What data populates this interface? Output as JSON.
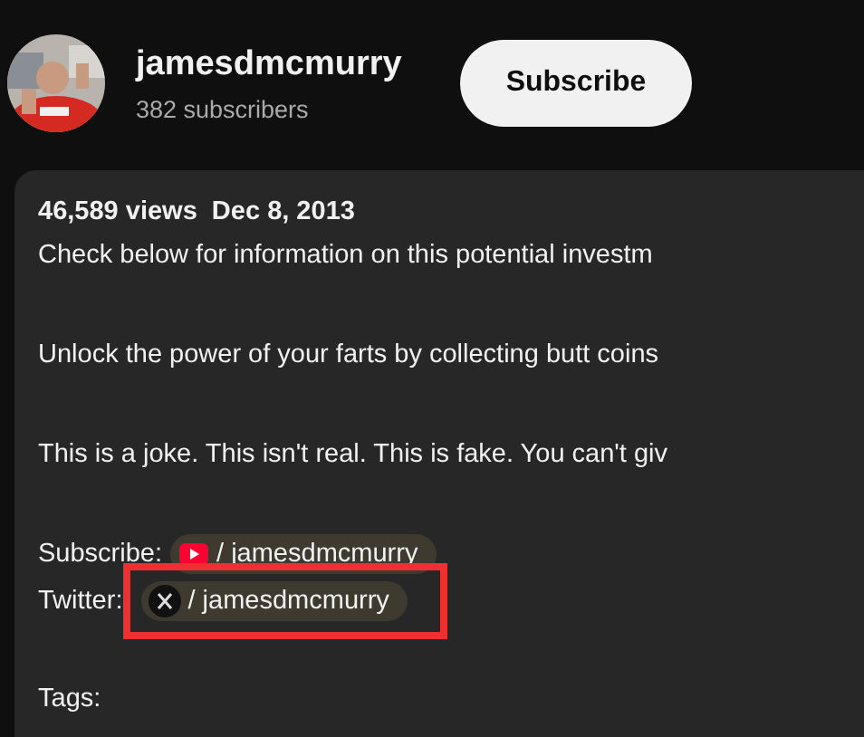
{
  "channel": {
    "name": "jamesdmcmurry",
    "subscribers": "382 subscribers",
    "subscribe_button": "Subscribe"
  },
  "description": {
    "stats": "46,589 views  Dec 8, 2013",
    "lines": [
      {
        "kind": "text",
        "text": "Check below for information on this potential investm"
      },
      {
        "kind": "blank"
      },
      {
        "kind": "text",
        "text": "Unlock the power of your farts by collecting butt coins"
      },
      {
        "kind": "blank"
      },
      {
        "kind": "text",
        "text": "This is a joke. This isn't real. This is fake. You can't giv"
      },
      {
        "kind": "blank"
      },
      {
        "kind": "youtube",
        "label": "Subscribe:",
        "link": "/ jamesdmcmurry"
      },
      {
        "kind": "twitter",
        "label": "Twitter:",
        "link": "/ jamesdmcmurry",
        "highlighted": true
      },
      {
        "kind": "blank"
      },
      {
        "kind": "text",
        "text": "Tags:"
      }
    ]
  }
}
